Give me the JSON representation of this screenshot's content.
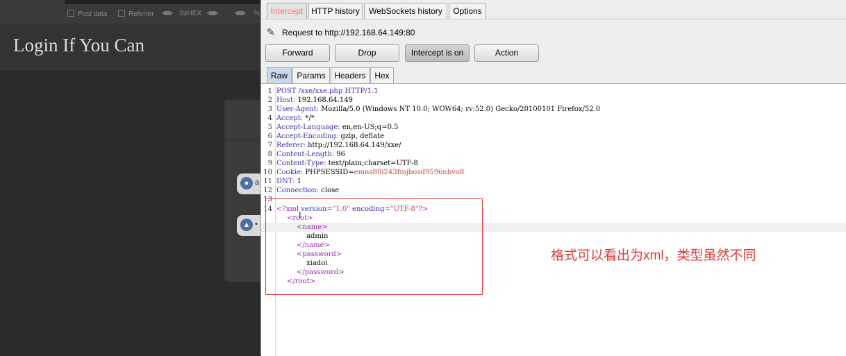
{
  "hackbar": {
    "post_data": "Post data",
    "referrer": "Referrer",
    "hex": "0xHEX",
    "pct": "%"
  },
  "site": {
    "title": "Login If You Can",
    "user_field_partial": "a",
    "pass_field_partial": "•"
  },
  "burp": {
    "tabs": [
      "Intercept",
      "HTTP history",
      "WebSockets history",
      "Options"
    ],
    "request_line": "Request to http://192.168.64.149:80",
    "buttons": {
      "forward": "Forward",
      "drop": "Drop",
      "intercept": "Intercept is on",
      "action": "Action"
    },
    "subtabs": [
      "Raw",
      "Params",
      "Headers",
      "Hex"
    ],
    "lines": [
      {
        "n": "1",
        "key": "POST /xxe/xxe.php HTTP/1.1",
        "val": ""
      },
      {
        "n": "2",
        "key": "Host:",
        "val": " 192.168.64.149"
      },
      {
        "n": "3",
        "key": "User-Agent:",
        "val": " Mozilla/5.0 (Windows NT 10.0; WOW64; rv:52.0) Gecko/20100101 Firefox/52.0"
      },
      {
        "n": "4",
        "key": "Accept:",
        "val": " */*"
      },
      {
        "n": "5",
        "key": "Accept-Language:",
        "val": " en,en-US;q=0.5"
      },
      {
        "n": "6",
        "key": "Accept-Encoding:",
        "val": " gzip, deflate"
      },
      {
        "n": "7",
        "key": "Referer:",
        "val": " http://192.168.64.149/xxe/"
      },
      {
        "n": "8",
        "key": "Content-Length:",
        "val": " 96"
      },
      {
        "n": "9",
        "key": "Content-Type:",
        "val": " text/plain;charset=UTF-8"
      },
      {
        "n": "10",
        "key": "Cookie:",
        "val": " PHPSESSID=",
        "red": "emns80i243fmjbosd9596nbvo8"
      },
      {
        "n": "11",
        "key": "DNT:",
        "val": " 1"
      },
      {
        "n": "12",
        "key": "Connection:",
        "val": " close"
      },
      {
        "n": "13",
        "key": "",
        "val": ""
      }
    ],
    "xml": {
      "decl_n": "14",
      "decl_open": "<?xml",
      "decl_version_attr": " version=",
      "decl_version_val": "\"1.0\"",
      "decl_enc_attr": " encoding=",
      "decl_enc_val": "\"UTF-8\"",
      "decl_close": "?>",
      "root_open": "<root>",
      "name_open": "<name>",
      "name_val": "admin",
      "name_close": "</name>",
      "pass_open": "<password>",
      "pass_val": "xiadoi",
      "pass_close": "</password>",
      "root_close": "</root>"
    }
  },
  "annotation": "格式可以看出为xml，类型虽然不同",
  "colors": {
    "accent_red": "#e53935",
    "intercept_tab": "#f08060",
    "xml_tag": "#9c27b0"
  }
}
